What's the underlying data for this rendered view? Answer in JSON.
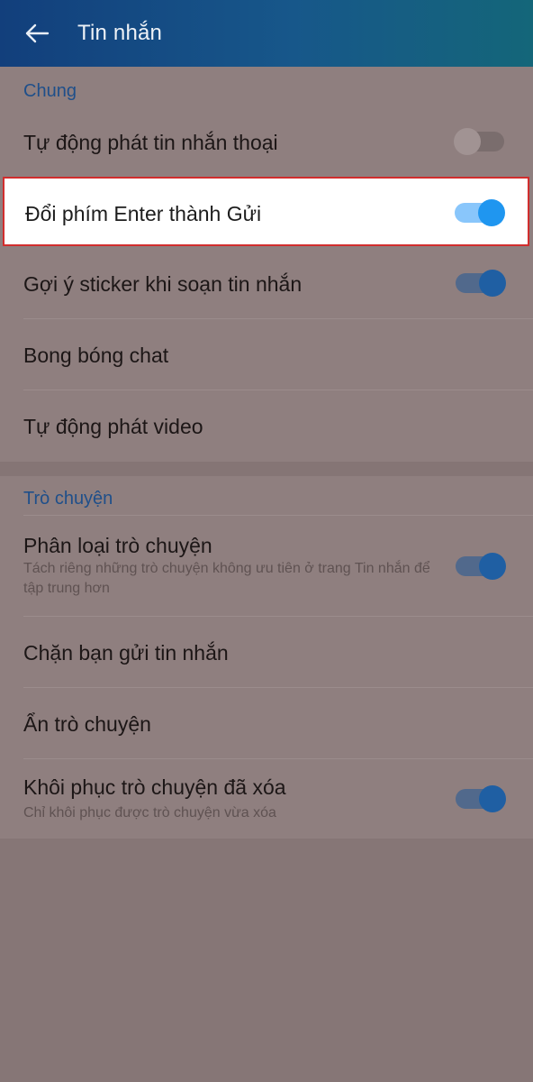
{
  "header": {
    "title": "Tin nhắn"
  },
  "sections": [
    {
      "label": "Chung",
      "items": [
        {
          "label": "Tự động phát tin nhắn thoại",
          "toggle": false
        },
        {
          "label": "Đổi phím Enter thành Gửi",
          "toggle": true
        },
        {
          "label": "Gợi ý sticker khi soạn tin nhắn",
          "toggle": true
        },
        {
          "label": "Bong bóng chat"
        },
        {
          "label": "Tự động phát video"
        }
      ]
    },
    {
      "label": "Trò chuyện",
      "items": [
        {
          "label": "Phân loại trò chuyện",
          "sub": "Tách riêng những trò chuyện không ưu tiên ở trang Tin nhắn để tập trung hơn",
          "toggle": true
        },
        {
          "label": "Chặn bạn gửi tin nhắn"
        },
        {
          "label": "Ẩn trò chuyện"
        },
        {
          "label": "Khôi phục trò chuyện đã xóa",
          "sub": "Chỉ khôi phục được trò chuyện vừa xóa",
          "toggle": true
        }
      ]
    }
  ],
  "colors": {
    "header": "#17578a",
    "accent": "#1f96f0",
    "highlight_border": "#d12d2d",
    "overlay": "#8f7f7f"
  }
}
